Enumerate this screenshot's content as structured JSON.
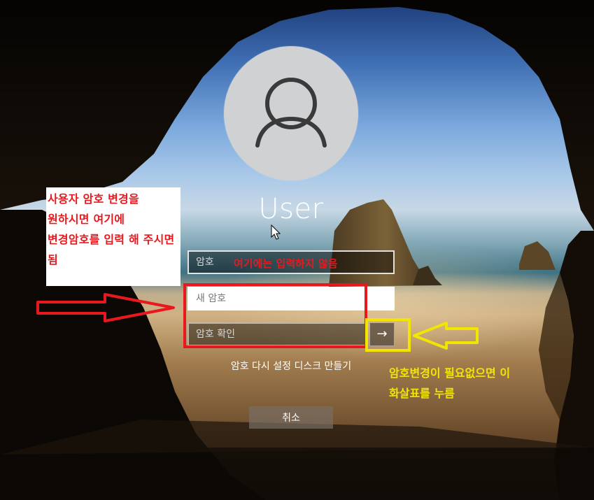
{
  "user": {
    "name": "User"
  },
  "form": {
    "old_password_placeholder": "암호",
    "new_password_placeholder": "새 암호",
    "confirm_password_placeholder": "암호 확인",
    "submit_glyph": "→",
    "reset_disk_link": "암호 다시 설정 디스크 만들기",
    "cancel_label": "취소"
  },
  "annotations": {
    "left_note": "사용자 암호 변경을 원하시면 여기에 변경암호를 입력 해 주시면 됨",
    "old_password_note": "여기에는 입력하지 않음",
    "right_note": "암호변경이 필요없으면 이 화살표를 누름",
    "left_note_color": "#e8191e",
    "right_note_color": "#f2e600"
  },
  "icons": {
    "avatar": "user-silhouette-icon",
    "submit": "arrow-right-icon",
    "pointer": "mouse-cursor-icon"
  }
}
